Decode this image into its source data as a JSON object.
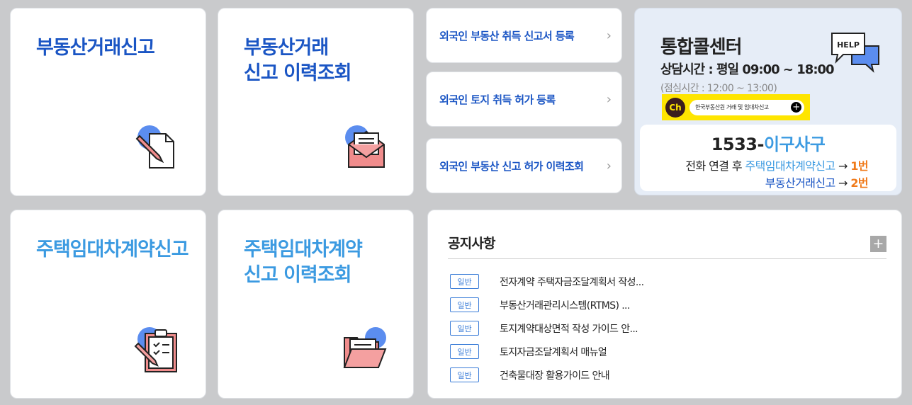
{
  "tiles": {
    "report": {
      "label": "부동산거래신고",
      "icon": "document-pen-icon"
    },
    "report_history": {
      "label": "부동산거래\n신고 이력조회",
      "icon": "envelope-letter-icon"
    },
    "lease": {
      "label": "주택임대차계약신고",
      "icon": "clipboard-checklist-icon"
    },
    "lease_history": {
      "label": "주택임대차계약\n신고 이력조회",
      "icon": "open-folder-icon"
    }
  },
  "foreign_links": [
    {
      "label": "외국인 부동산 취득 신고서 등록"
    },
    {
      "label": "외국인 토지 취득 허가 등록"
    },
    {
      "label": "외국인 부동산 신고 허가 이력조회"
    }
  ],
  "call_center": {
    "title": "통합콜센터",
    "hours": "상담시간 : 평일 09:00 ~ 18:00",
    "lunch": "(점심시간 : 12:00 ~ 13:00)",
    "help_icon_text": "HELP",
    "kakao_label": "Ch",
    "kakao_text": "한국부동산원 거래 및 임대차신고",
    "phone_number": "1533-",
    "phone_word": "이구사구",
    "line1_prefix": "전화 연결 후 ",
    "line1_service": "주택임대차계약신고",
    "line1_arrow": " → ",
    "line1_option": "1번",
    "line2_service": "부동산거래신고",
    "line2_arrow": " → ",
    "line2_option": "2번"
  },
  "notice": {
    "title": "공지사항",
    "more": "+",
    "items": [
      {
        "badge": "일반",
        "text": "전자계약 주택자금조달계획서 작성..."
      },
      {
        "badge": "일반",
        "text": "부동산거래관리시스템(RTMS) ..."
      },
      {
        "badge": "일반",
        "text": "토지계약대상면적 작성 가이드 안..."
      },
      {
        "badge": "일반",
        "text": "토지자금조달계획서 매뉴얼"
      },
      {
        "badge": "일반",
        "text": "건축물대장 활용가이드 안내"
      }
    ]
  },
  "colors": {
    "dark_blue": "#1a55c4",
    "light_blue": "#3b9ae1",
    "orange": "#f07a1a",
    "kakao_yellow": "#fee500"
  }
}
